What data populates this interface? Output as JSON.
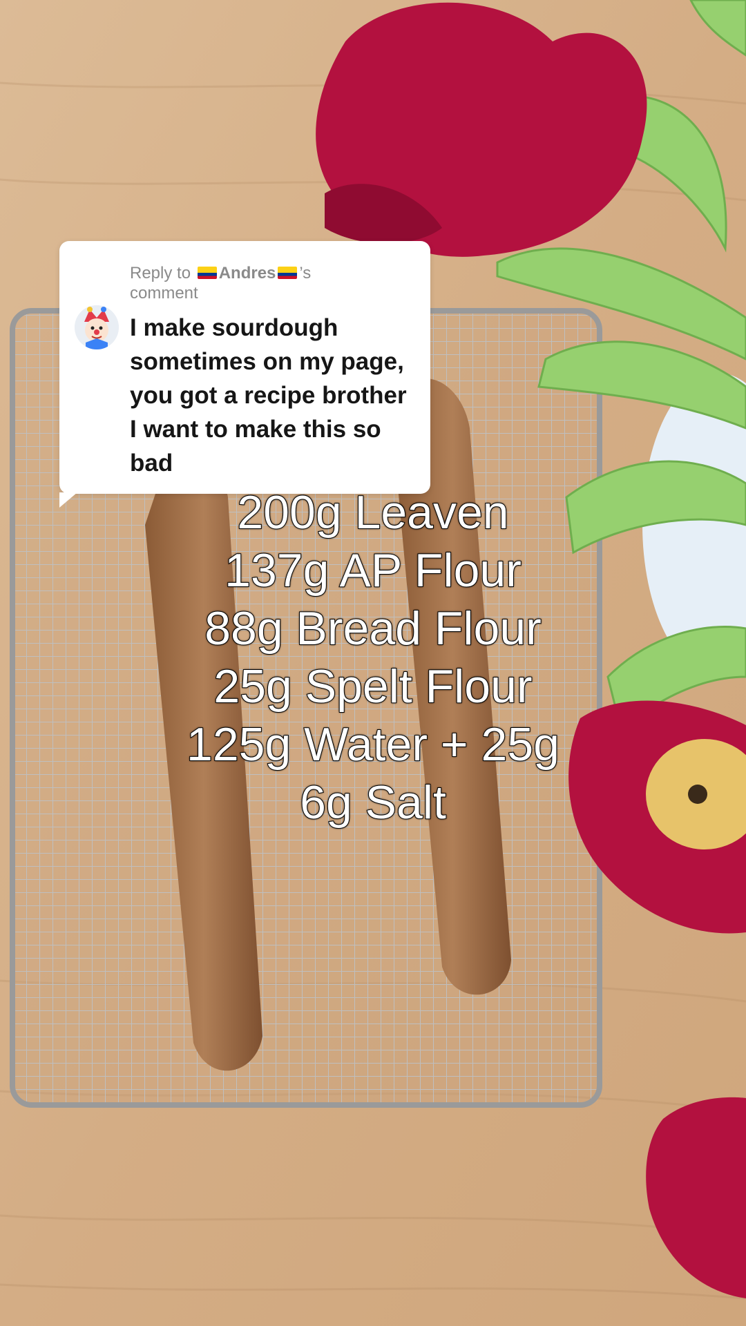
{
  "comment": {
    "reply_prefix": "Reply to ",
    "username": "Andres",
    "reply_suffix": "’s",
    "reply_line2": "comment",
    "text": "I make sourdough sometimes on my page, you got a recipe brother I want to make this so bad",
    "flag_icon": "colombia-flag-icon",
    "avatar_icon": "clown-emoji-icon"
  },
  "recipe": {
    "lines": [
      "200g Leaven",
      "137g AP Flour",
      "88g Bread Flour",
      "25g Spelt Flour",
      "125g Water + 25g",
      "6g Salt"
    ]
  },
  "colors": {
    "wood": "#d9b48e",
    "rack": "#b8b8b8",
    "tulip": "#b4123f",
    "leaf": "#8fcf6a",
    "vase": "#e8f1f8"
  }
}
